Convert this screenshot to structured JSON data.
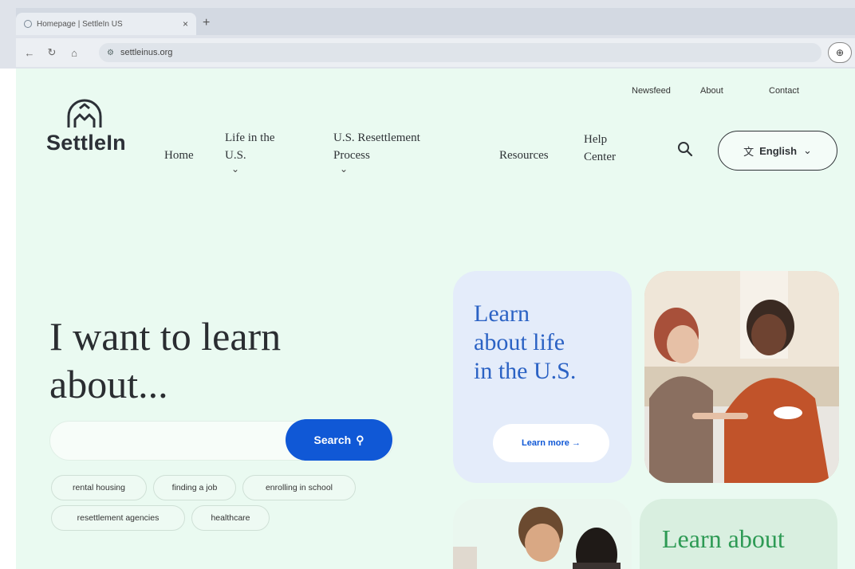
{
  "browser": {
    "tab_title": "Homepage | SettleIn US",
    "tab_close": "×",
    "new_tab": "+",
    "url": "settleinus.org",
    "nav": {
      "back": "←",
      "reload": "↻",
      "home": "⌂"
    }
  },
  "utility_nav": {
    "newsfeed": "Newsfeed",
    "about": "About",
    "contact": "Contact"
  },
  "logo": {
    "text": "SettleIn",
    "icon": "house-arch-icon"
  },
  "main_nav": {
    "home": "Home",
    "life_line1": "Life in the",
    "life_line2": "U.S.",
    "process_line1": "U.S. Resettlement",
    "process_line2": "Process",
    "resources": "Resources",
    "help_line1": "Help",
    "help_line2": "Center",
    "chevron": "⌄"
  },
  "language": {
    "label": "English",
    "icon": "translate-icon"
  },
  "hero": {
    "heading_line1": "I want to learn",
    "heading_line2": "about...",
    "search_placeholder": "",
    "search_button": "Search",
    "chips": [
      "rental housing",
      "finding a job",
      "enrolling in school",
      "resettlement agencies",
      "healthcare"
    ]
  },
  "cards": {
    "learn_title_line1": "Learn",
    "learn_title_line2": "about life",
    "learn_title_line3": "in the U.S.",
    "learn_more": "Learn more →",
    "green_title": "Learn about"
  },
  "colors": {
    "page_bg": "#eafaf1",
    "primary_blue": "#1058d6",
    "card_blue_bg": "#e4ecfa",
    "card_blue_text": "#2b62c4",
    "green_text": "#2d9a54"
  }
}
